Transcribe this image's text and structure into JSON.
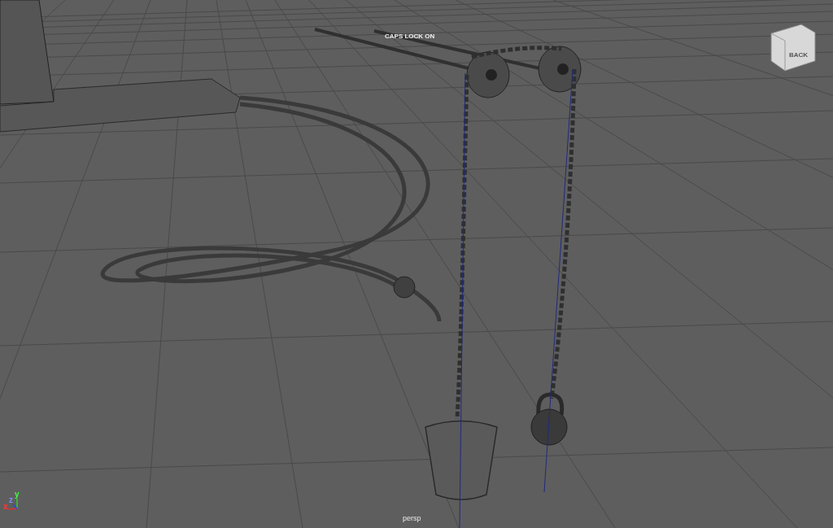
{
  "viewport": {
    "hud_message": "CAPS LOCK ON",
    "camera_name": "persp"
  },
  "view_cube": {
    "face_label": "BACK"
  },
  "axis_gizmo": {
    "labels": [
      "x",
      "y",
      "z"
    ]
  }
}
